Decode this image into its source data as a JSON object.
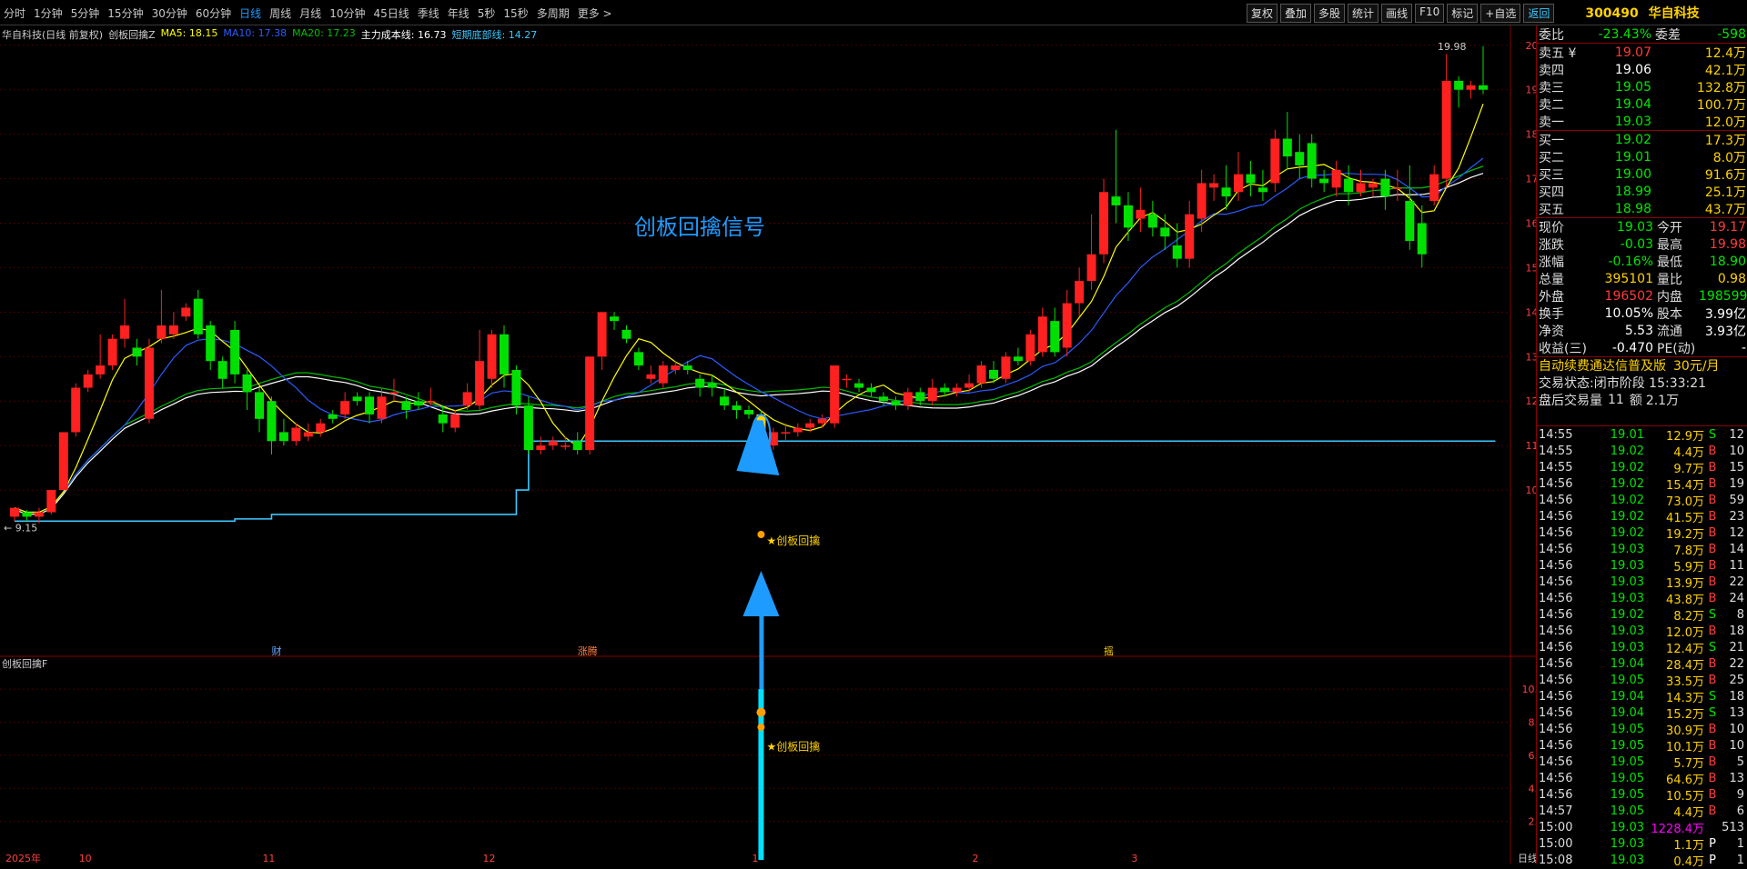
{
  "toolbar": {
    "periods": [
      "分时",
      "1分钟",
      "5分钟",
      "15分钟",
      "30分钟",
      "60分钟",
      "日线",
      "周线",
      "月线",
      "10分钟",
      "45日线",
      "季线",
      "年线",
      "5秒",
      "15秒",
      "多周期",
      "更多 >"
    ],
    "active_period": "日线",
    "buttons": [
      "复权",
      "叠加",
      "多股",
      "统计",
      "画线",
      "F10",
      "标记",
      "+自选",
      "返回"
    ]
  },
  "stock": {
    "code": "300490",
    "name": "华自科技"
  },
  "legend": {
    "title": "华自科技(日线 前复权)",
    "indicator": "创板回擒Z",
    "ma5": "MA5: 18.15",
    "ma10": "MA10: 17.38",
    "ma20": "MA20: 17.23",
    "cost": "主力成本线: 16.73",
    "bottom": "短期底部线: 14.27",
    "colors": {
      "ma5": "#ffff00",
      "ma10": "#2a5cff",
      "ma20": "#00c000",
      "cost": "#ffffff",
      "bottom": "#3cc8ff"
    }
  },
  "sub_legend": "创板回擒F",
  "annotation": {
    "title": "创板回擒信号",
    "signal_label": "★创板回擒",
    "sub_label": "★创板回擒"
  },
  "events": [
    "财",
    "涨腾",
    "摇"
  ],
  "main_axis": {
    "ticks": [
      "20.00",
      "19.00",
      "18.00",
      "17.00",
      "16.00",
      "15.00",
      "14.00",
      "13.00",
      "12.00",
      "11.00",
      "10.00"
    ],
    "max_label": "19.98",
    "min_label": "9.15"
  },
  "sub_axis": {
    "ticks": [
      "10.00",
      "8.00",
      "6.00",
      "4.00",
      "2.00"
    ]
  },
  "x_axis": {
    "labels": [
      "2025年",
      "10",
      "11",
      "12",
      "1",
      "2",
      "3"
    ],
    "period_label": "日线"
  },
  "chart_data": {
    "type": "candlestick",
    "candles": [
      [
        9.4,
        9.6,
        9.3,
        9.5
      ],
      [
        9.5,
        9.4,
        9.3,
        9.55
      ],
      [
        9.4,
        9.5,
        9.25,
        9.6
      ],
      [
        9.5,
        10.0,
        9.45,
        10.0
      ],
      [
        10.0,
        11.3,
        10.0,
        11.3
      ],
      [
        11.3,
        12.3,
        11.2,
        12.4
      ],
      [
        12.3,
        12.6,
        12.2,
        12.7
      ],
      [
        12.6,
        12.8,
        12.5,
        13.5
      ],
      [
        12.8,
        13.4,
        12.7,
        13.5
      ],
      [
        13.4,
        13.7,
        13.2,
        14.3
      ],
      [
        13.2,
        13.0,
        12.8,
        13.4
      ],
      [
        11.6,
        13.2,
        11.5,
        13.4
      ],
      [
        13.4,
        13.7,
        13.3,
        14.5
      ],
      [
        13.5,
        13.7,
        13.4,
        14.0
      ],
      [
        13.9,
        14.1,
        13.8,
        14.2
      ],
      [
        14.3,
        13.5,
        13.4,
        14.5
      ],
      [
        13.7,
        12.9,
        12.7,
        13.8
      ],
      [
        12.9,
        12.5,
        12.3,
        13.0
      ],
      [
        13.6,
        12.6,
        12.4,
        13.8
      ],
      [
        12.6,
        12.2,
        11.8,
        12.7
      ],
      [
        12.2,
        11.6,
        11.3,
        12.3
      ],
      [
        12.0,
        11.1,
        10.8,
        12.1
      ],
      [
        11.3,
        11.1,
        11.0,
        11.6
      ],
      [
        11.1,
        11.4,
        11.0,
        11.5
      ],
      [
        11.2,
        11.3,
        11.1,
        11.5
      ],
      [
        11.3,
        11.5,
        11.2,
        11.6
      ],
      [
        11.7,
        11.6,
        11.5,
        11.8
      ],
      [
        11.7,
        12.0,
        11.6,
        12.2
      ],
      [
        12.1,
        12.0,
        11.9,
        12.2
      ],
      [
        12.1,
        11.7,
        11.5,
        12.2
      ],
      [
        11.6,
        12.1,
        11.5,
        12.3
      ],
      [
        12.2,
        12.2,
        12.0,
        12.5
      ],
      [
        12.0,
        11.8,
        11.6,
        12.1
      ],
      [
        12.0,
        11.9,
        11.8,
        12.2
      ],
      [
        12.0,
        12.0,
        11.9,
        12.3
      ],
      [
        11.7,
        11.5,
        11.3,
        11.9
      ],
      [
        11.4,
        11.7,
        11.3,
        11.8
      ],
      [
        11.9,
        12.2,
        11.8,
        12.4
      ],
      [
        11.9,
        12.9,
        11.8,
        13.6
      ],
      [
        12.5,
        13.5,
        12.3,
        13.6
      ],
      [
        13.5,
        12.6,
        12.3,
        13.7
      ],
      [
        12.7,
        11.9,
        11.7,
        12.8
      ],
      [
        11.9,
        10.9,
        10.8,
        12.1
      ],
      [
        10.9,
        11.0,
        10.8,
        11.2
      ],
      [
        11.0,
        11.1,
        10.9,
        11.2
      ],
      [
        11.0,
        11.0,
        10.9,
        11.2
      ],
      [
        11.1,
        10.9,
        10.8,
        11.3
      ],
      [
        10.9,
        13.0,
        10.8,
        13.0
      ],
      [
        13.0,
        14.0,
        12.7,
        14.0
      ],
      [
        13.9,
        13.8,
        13.6,
        14.0
      ],
      [
        13.6,
        13.4,
        13.3,
        13.7
      ],
      [
        13.1,
        12.8,
        12.7,
        13.2
      ],
      [
        12.5,
        12.6,
        12.4,
        12.8
      ],
      [
        12.4,
        12.8,
        12.3,
        12.9
      ],
      [
        12.7,
        12.8,
        12.6,
        12.9
      ],
      [
        12.8,
        12.7,
        12.6,
        12.9
      ],
      [
        12.5,
        12.3,
        12.1,
        12.6
      ],
      [
        12.4,
        12.3,
        12.1,
        12.6
      ],
      [
        12.1,
        11.9,
        11.8,
        12.3
      ],
      [
        11.9,
        11.8,
        11.6,
        12.0
      ],
      [
        11.8,
        11.7,
        11.6,
        11.9
      ],
      [
        11.7,
        11.2,
        11.0,
        11.8
      ],
      [
        11.0,
        11.3,
        10.9,
        11.4
      ],
      [
        11.3,
        11.3,
        11.1,
        11.5
      ],
      [
        11.3,
        11.4,
        11.2,
        11.5
      ],
      [
        11.4,
        11.5,
        11.3,
        11.6
      ],
      [
        11.5,
        11.6,
        11.4,
        11.7
      ],
      [
        11.5,
        12.8,
        11.4,
        12.8
      ],
      [
        12.5,
        12.5,
        12.3,
        12.6
      ],
      [
        12.4,
        12.3,
        12.2,
        12.5
      ],
      [
        12.3,
        12.2,
        12.1,
        12.4
      ],
      [
        12.1,
        12.0,
        11.9,
        12.2
      ],
      [
        12.0,
        11.9,
        11.8,
        12.1
      ],
      [
        11.9,
        12.2,
        11.8,
        12.3
      ],
      [
        12.2,
        12.0,
        11.9,
        12.3
      ],
      [
        12.0,
        12.3,
        11.9,
        12.5
      ],
      [
        12.3,
        12.2,
        12.1,
        12.4
      ],
      [
        12.2,
        12.3,
        12.1,
        12.4
      ],
      [
        12.3,
        12.4,
        12.2,
        12.6
      ],
      [
        12.4,
        12.8,
        12.3,
        12.9
      ],
      [
        12.7,
        12.5,
        12.4,
        12.9
      ],
      [
        12.5,
        13.0,
        12.4,
        13.1
      ],
      [
        13.0,
        12.9,
        12.8,
        13.2
      ],
      [
        12.9,
        13.5,
        12.8,
        13.6
      ],
      [
        13.1,
        13.9,
        13.0,
        14.1
      ],
      [
        13.8,
        13.1,
        13.0,
        14.1
      ],
      [
        13.2,
        14.2,
        13.0,
        14.5
      ],
      [
        14.2,
        14.7,
        13.9,
        15.0
      ],
      [
        14.7,
        15.3,
        14.5,
        16.2
      ],
      [
        15.3,
        16.7,
        15.1,
        17.0
      ],
      [
        16.6,
        16.4,
        16.0,
        18.1
      ],
      [
        16.4,
        15.9,
        15.6,
        16.7
      ],
      [
        16.1,
        16.3,
        15.8,
        16.8
      ],
      [
        16.2,
        15.9,
        15.7,
        16.5
      ],
      [
        15.9,
        15.7,
        15.4,
        16.2
      ],
      [
        15.5,
        15.2,
        15.0,
        16.0
      ],
      [
        15.2,
        16.2,
        15.0,
        16.5
      ],
      [
        16.1,
        16.9,
        15.8,
        17.2
      ],
      [
        16.8,
        16.9,
        16.5,
        17.1
      ],
      [
        16.8,
        16.6,
        16.3,
        17.3
      ],
      [
        16.7,
        17.1,
        16.5,
        17.6
      ],
      [
        17.1,
        16.9,
        16.6,
        17.4
      ],
      [
        16.8,
        16.7,
        16.5,
        17.2
      ],
      [
        16.9,
        17.9,
        16.7,
        18.1
      ],
      [
        17.9,
        17.5,
        17.2,
        18.5
      ],
      [
        17.6,
        17.3,
        17.0,
        18.0
      ],
      [
        17.8,
        17.0,
        16.8,
        18.0
      ],
      [
        17.0,
        16.9,
        16.7,
        17.2
      ],
      [
        16.8,
        17.2,
        16.6,
        17.4
      ],
      [
        17.0,
        16.7,
        16.4,
        17.3
      ],
      [
        16.7,
        16.9,
        16.6,
        17.2
      ],
      [
        16.8,
        16.9,
        16.6,
        17.0
      ],
      [
        17.0,
        16.6,
        16.3,
        17.2
      ],
      [
        16.8,
        16.8,
        16.5,
        17.2
      ],
      [
        16.5,
        15.6,
        15.4,
        17.3
      ],
      [
        16.0,
        15.3,
        15.0,
        16.4
      ],
      [
        16.5,
        17.1,
        16.4,
        17.3
      ],
      [
        17.0,
        19.2,
        16.8,
        19.8
      ],
      [
        19.2,
        19.0,
        18.6,
        19.3
      ],
      [
        19.0,
        19.1,
        18.8,
        19.2
      ],
      [
        19.1,
        19.0,
        18.9,
        19.98
      ]
    ],
    "bottom_line": [
      9.3,
      9.3,
      9.3,
      9.3,
      9.3,
      9.3,
      9.3,
      9.3,
      9.3,
      9.3,
      9.3,
      9.3,
      9.3,
      9.3,
      9.3,
      9.3,
      9.3,
      9.3,
      9.35,
      9.35,
      9.35,
      9.45,
      9.45,
      9.45,
      9.45,
      9.45,
      9.45,
      9.45,
      9.45,
      9.45,
      9.45,
      9.45,
      9.45,
      9.45,
      9.45,
      9.45,
      9.45,
      9.45,
      9.45,
      9.45,
      9.45,
      10.0,
      11.1,
      11.1,
      11.1,
      11.1,
      11.1,
      11.1,
      11.1,
      11.1,
      11.1,
      11.1,
      11.1,
      11.1,
      11.1,
      11.1,
      11.1,
      11.1,
      11.1,
      11.1,
      11.1,
      11.1,
      11.1,
      11.1,
      11.1,
      11.1,
      11.1,
      11.1,
      11.1,
      11.1,
      11.1,
      11.1,
      11.1,
      11.1,
      11.1,
      11.1,
      11.1,
      11.1,
      11.1,
      11.1,
      11.1,
      11.1,
      11.1,
      11.1,
      11.1,
      11.1,
      11.1,
      11.1,
      11.1,
      11.1,
      11.1,
      11.1,
      11.1,
      11.1,
      11.1,
      11.1,
      11.1,
      11.1,
      11.1,
      11.1,
      11.1,
      11.1,
      11.1,
      11.1,
      11.1,
      11.1,
      11.1,
      11.1,
      11.1,
      11.1,
      11.1,
      11.1,
      11.1,
      11.1,
      11.1,
      11.1,
      11.1,
      11.1,
      11.1,
      11.1,
      11.1
    ],
    "signal_index": 61,
    "sub_series_max": 10.0
  },
  "order_book": {
    "wb_label": "委比",
    "wb": "-23.43%",
    "wc_label": "委差",
    "wc": "-598",
    "asks": [
      {
        "label": "卖五 ¥",
        "price": "19.07",
        "vol": "12.4万"
      },
      {
        "label": "卖四",
        "price": "19.06",
        "vol": "42.1万"
      },
      {
        "label": "卖三",
        "price": "19.05",
        "vol": "132.8万"
      },
      {
        "label": "卖二",
        "price": "19.04",
        "vol": "100.7万"
      },
      {
        "label": "卖一",
        "price": "19.03",
        "vol": "12.0万"
      }
    ],
    "bids": [
      {
        "label": "买一",
        "price": "19.02",
        "vol": "17.3万"
      },
      {
        "label": "买二",
        "price": "19.01",
        "vol": "8.0万"
      },
      {
        "label": "买三",
        "price": "19.00",
        "vol": "91.6万"
      },
      {
        "label": "买四",
        "price": "18.99",
        "vol": "25.1万"
      },
      {
        "label": "买五",
        "price": "18.98",
        "vol": "43.7万"
      }
    ]
  },
  "quote": [
    {
      "l1": "现价",
      "v1": "19.03",
      "c1": "green",
      "l2": "今开",
      "v2": "19.17",
      "c2": "red"
    },
    {
      "l1": "涨跌",
      "v1": "-0.03",
      "c1": "green",
      "l2": "最高",
      "v2": "19.98",
      "c2": "red"
    },
    {
      "l1": "涨幅",
      "v1": "-0.16%",
      "c1": "green",
      "l2": "最低",
      "v2": "18.90",
      "c2": "green"
    },
    {
      "l1": "总量",
      "v1": "395101",
      "c1": "yellow",
      "l2": "量比",
      "v2": "0.98",
      "c2": "yellow"
    },
    {
      "l1": "外盘",
      "v1": "196502",
      "c1": "red",
      "l2": "内盘",
      "v2": "198599",
      "c2": "green"
    },
    {
      "l1": "换手",
      "v1": "10.05%",
      "c1": "white",
      "l2": "股本",
      "v2": "3.99亿",
      "c2": "white"
    },
    {
      "l1": "净资",
      "v1": "5.53",
      "c1": "white",
      "l2": "流通",
      "v2": "3.93亿",
      "c2": "white"
    },
    {
      "l1": "收益(三)",
      "v1": "-0.470",
      "c1": "white",
      "l2": "PE(动)",
      "v2": "-",
      "c2": "white"
    }
  ],
  "promo": {
    "text": "自动续费通达信普及版",
    "price": "30元/月"
  },
  "status": {
    "label": "交易状态:",
    "value": "闭市阶段 15:33:21"
  },
  "after_hours": {
    "label": "盘后交易量",
    "vol": "11",
    "amt_label": "额",
    "amt": "2.1万"
  },
  "ticks": [
    {
      "t": "14:55",
      "p": "19.01",
      "v": "12.9万",
      "s": "S",
      "n": "12"
    },
    {
      "t": "14:55",
      "p": "19.02",
      "v": "4.4万",
      "s": "B",
      "n": "10"
    },
    {
      "t": "14:55",
      "p": "19.02",
      "v": "9.7万",
      "s": "B",
      "n": "15"
    },
    {
      "t": "14:56",
      "p": "19.02",
      "v": "15.4万",
      "s": "B",
      "n": "19"
    },
    {
      "t": "14:56",
      "p": "19.02",
      "v": "73.0万",
      "s": "B",
      "n": "59"
    },
    {
      "t": "14:56",
      "p": "19.02",
      "v": "41.5万",
      "s": "B",
      "n": "23"
    },
    {
      "t": "14:56",
      "p": "19.02",
      "v": "19.2万",
      "s": "B",
      "n": "12"
    },
    {
      "t": "14:56",
      "p": "19.03",
      "v": "7.8万",
      "s": "B",
      "n": "14"
    },
    {
      "t": "14:56",
      "p": "19.03",
      "v": "5.9万",
      "s": "B",
      "n": "11"
    },
    {
      "t": "14:56",
      "p": "19.03",
      "v": "13.9万",
      "s": "B",
      "n": "22"
    },
    {
      "t": "14:56",
      "p": "19.03",
      "v": "43.8万",
      "s": "B",
      "n": "24"
    },
    {
      "t": "14:56",
      "p": "19.02",
      "v": "8.2万",
      "s": "S",
      "n": "8"
    },
    {
      "t": "14:56",
      "p": "19.03",
      "v": "12.0万",
      "s": "B",
      "n": "18"
    },
    {
      "t": "14:56",
      "p": "19.03",
      "v": "12.4万",
      "s": "S",
      "n": "21"
    },
    {
      "t": "14:56",
      "p": "19.04",
      "v": "28.4万",
      "s": "B",
      "n": "22"
    },
    {
      "t": "14:56",
      "p": "19.05",
      "v": "33.5万",
      "s": "B",
      "n": "25"
    },
    {
      "t": "14:56",
      "p": "19.04",
      "v": "14.3万",
      "s": "S",
      "n": "18"
    },
    {
      "t": "14:56",
      "p": "19.04",
      "v": "15.2万",
      "s": "S",
      "n": "13"
    },
    {
      "t": "14:56",
      "p": "19.05",
      "v": "30.9万",
      "s": "B",
      "n": "10"
    },
    {
      "t": "14:56",
      "p": "19.05",
      "v": "10.1万",
      "s": "B",
      "n": "10"
    },
    {
      "t": "14:56",
      "p": "19.05",
      "v": "5.7万",
      "s": "B",
      "n": "5"
    },
    {
      "t": "14:56",
      "p": "19.05",
      "v": "64.6万",
      "s": "B",
      "n": "13"
    },
    {
      "t": "14:56",
      "p": "19.05",
      "v": "10.5万",
      "s": "B",
      "n": "9"
    },
    {
      "t": "14:57",
      "p": "19.05",
      "v": "4.4万",
      "s": "B",
      "n": "6"
    },
    {
      "t": "15:00",
      "p": "19.03",
      "v": "1228.4万",
      "s": "",
      "n": "513"
    },
    {
      "t": "15:00",
      "p": "19.03",
      "v": "1.1万",
      "s": "P",
      "n": "1"
    },
    {
      "t": "15:08",
      "p": "19.03",
      "v": "0.4万",
      "s": "P",
      "n": "1"
    }
  ]
}
